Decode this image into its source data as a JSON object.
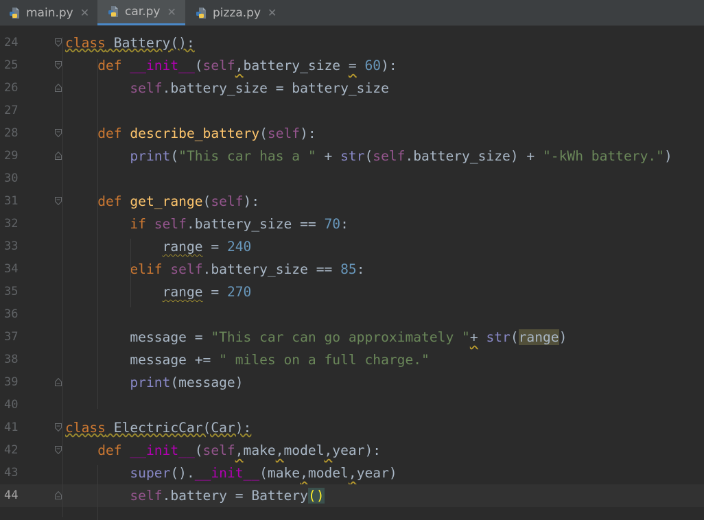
{
  "tabs": [
    {
      "name": "main.py",
      "active": false
    },
    {
      "name": "car.py",
      "active": true
    },
    {
      "name": "pizza.py",
      "active": false
    }
  ],
  "lines": [
    {
      "n": "24",
      "fold": "open",
      "tokens": [
        {
          "t": "class",
          "c": "kw"
        },
        {
          "t": " Battery():",
          "c": ""
        }
      ],
      "wavy": true
    },
    {
      "n": "25",
      "fold": "open",
      "tokens": [
        {
          "t": "    "
        },
        {
          "t": "def",
          "c": "kw"
        },
        {
          "t": " "
        },
        {
          "t": "__init__",
          "c": "magic"
        },
        {
          "t": "("
        },
        {
          "t": "self",
          "c": "self"
        },
        {
          "t": ",",
          "c": "warn"
        },
        {
          "t": "battery_size "
        },
        {
          "t": "=",
          "c": "warn"
        },
        {
          "t": " "
        },
        {
          "t": "60",
          "c": "num"
        },
        {
          "t": "):"
        }
      ]
    },
    {
      "n": "26",
      "fold": "close",
      "tokens": [
        {
          "t": "        "
        },
        {
          "t": "self",
          "c": "self"
        },
        {
          "t": ".battery_size = battery_size"
        }
      ]
    },
    {
      "n": "27",
      "fold": "",
      "tokens": []
    },
    {
      "n": "28",
      "fold": "open",
      "tokens": [
        {
          "t": "    "
        },
        {
          "t": "def",
          "c": "kw"
        },
        {
          "t": " "
        },
        {
          "t": "describe_battery",
          "c": "fn"
        },
        {
          "t": "("
        },
        {
          "t": "self",
          "c": "self"
        },
        {
          "t": "):"
        }
      ]
    },
    {
      "n": "29",
      "fold": "close",
      "tokens": [
        {
          "t": "        "
        },
        {
          "t": "print",
          "c": "bi"
        },
        {
          "t": "("
        },
        {
          "t": "\"This car has a \"",
          "c": "str"
        },
        {
          "t": " + "
        },
        {
          "t": "str",
          "c": "bi"
        },
        {
          "t": "("
        },
        {
          "t": "self",
          "c": "self"
        },
        {
          "t": ".battery_size) + "
        },
        {
          "t": "\"-kWh battery.\"",
          "c": "str"
        },
        {
          "t": ")"
        }
      ]
    },
    {
      "n": "30",
      "fold": "",
      "tokens": []
    },
    {
      "n": "31",
      "fold": "open",
      "tokens": [
        {
          "t": "    "
        },
        {
          "t": "def",
          "c": "kw"
        },
        {
          "t": " "
        },
        {
          "t": "get_range",
          "c": "fn"
        },
        {
          "t": "("
        },
        {
          "t": "self",
          "c": "self"
        },
        {
          "t": "):"
        }
      ]
    },
    {
      "n": "32",
      "fold": "",
      "tokens": [
        {
          "t": "        "
        },
        {
          "t": "if",
          "c": "kw"
        },
        {
          "t": " "
        },
        {
          "t": "self",
          "c": "self"
        },
        {
          "t": ".battery_size == "
        },
        {
          "t": "70",
          "c": "num"
        },
        {
          "t": ":"
        }
      ]
    },
    {
      "n": "33",
      "fold": "",
      "tokens": [
        {
          "t": "            "
        },
        {
          "t": "range",
          "c": "wavy"
        },
        {
          "t": " = "
        },
        {
          "t": "240",
          "c": "num"
        }
      ]
    },
    {
      "n": "34",
      "fold": "",
      "tokens": [
        {
          "t": "        "
        },
        {
          "t": "elif",
          "c": "kw"
        },
        {
          "t": " "
        },
        {
          "t": "self",
          "c": "self"
        },
        {
          "t": ".battery_size == "
        },
        {
          "t": "85",
          "c": "num"
        },
        {
          "t": ":"
        }
      ]
    },
    {
      "n": "35",
      "fold": "",
      "tokens": [
        {
          "t": "            "
        },
        {
          "t": "range",
          "c": "wavy"
        },
        {
          "t": " = "
        },
        {
          "t": "270",
          "c": "num"
        }
      ]
    },
    {
      "n": "36",
      "fold": "",
      "tokens": []
    },
    {
      "n": "37",
      "fold": "",
      "tokens": [
        {
          "t": "        message = "
        },
        {
          "t": "\"This car can go approximately \"",
          "c": "str"
        },
        {
          "t": "+",
          "c": "warn"
        },
        {
          "t": " "
        },
        {
          "t": "str",
          "c": "bi"
        },
        {
          "t": "("
        },
        {
          "t": "range",
          "c": "hl"
        },
        {
          "t": ")"
        }
      ]
    },
    {
      "n": "38",
      "fold": "",
      "tokens": [
        {
          "t": "        message += "
        },
        {
          "t": "\" miles on a full charge.\"",
          "c": "str"
        }
      ]
    },
    {
      "n": "39",
      "fold": "close",
      "tokens": [
        {
          "t": "        "
        },
        {
          "t": "print",
          "c": "bi"
        },
        {
          "t": "(message)"
        }
      ]
    },
    {
      "n": "40",
      "fold": "",
      "tokens": []
    },
    {
      "n": "41",
      "fold": "open",
      "tokens": [
        {
          "t": "class",
          "c": "kw"
        },
        {
          "t": " ElectricCar(Car):",
          "c": ""
        }
      ],
      "wavy": true
    },
    {
      "n": "42",
      "fold": "open",
      "tokens": [
        {
          "t": "    "
        },
        {
          "t": "def",
          "c": "kw"
        },
        {
          "t": " "
        },
        {
          "t": "__init__",
          "c": "magic"
        },
        {
          "t": "("
        },
        {
          "t": "self",
          "c": "self"
        },
        {
          "t": ",",
          "c": "warn"
        },
        {
          "t": "make"
        },
        {
          "t": ",",
          "c": "warn"
        },
        {
          "t": "model"
        },
        {
          "t": ",",
          "c": "warn"
        },
        {
          "t": "year):"
        }
      ]
    },
    {
      "n": "43",
      "fold": "",
      "tokens": [
        {
          "t": "        "
        },
        {
          "t": "super",
          "c": "bi"
        },
        {
          "t": "()."
        },
        {
          "t": "__init__",
          "c": "magic"
        },
        {
          "t": "(make"
        },
        {
          "t": ",",
          "c": "warn"
        },
        {
          "t": "model"
        },
        {
          "t": ",",
          "c": "warn"
        },
        {
          "t": "year)"
        }
      ]
    },
    {
      "n": "44",
      "fold": "close",
      "current": true,
      "tokens": [
        {
          "t": "        "
        },
        {
          "t": "self",
          "c": "self"
        },
        {
          "t": ".battery = Battery"
        },
        {
          "t": "()",
          "c": "brace"
        }
      ]
    }
  ]
}
